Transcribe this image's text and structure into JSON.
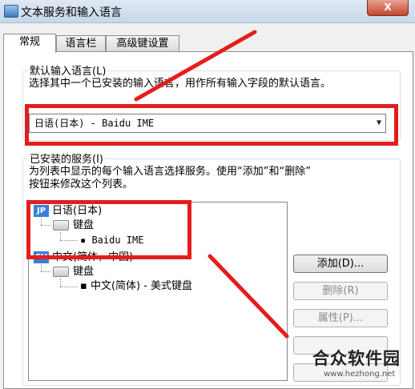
{
  "window": {
    "title": "文本服务和输入语言",
    "close_glyph": "X"
  },
  "tabs": [
    {
      "label": "常规",
      "active": true
    },
    {
      "label": "语言栏",
      "active": false
    },
    {
      "label": "高级键设置",
      "active": false
    }
  ],
  "default_language": {
    "group_label": "默认输入语言(L)",
    "description": "选择其中一个已安装的输入语言，用作所有输入字段的默认语言。",
    "selected": "日语(日本) - Baidu IME",
    "arrow_glyph": "▼"
  },
  "installed_services": {
    "group_label": "已安装的服务(I)",
    "description_line1": "为列表中显示的每个输入语言选择服务。使用“添加”和“删除”",
    "description_line2": "按钮来修改这个列表。",
    "tree": [
      {
        "badge": "JP",
        "language": "日语(日本)",
        "category": "键盘",
        "service": "Baidu IME"
      },
      {
        "badge": "CH",
        "language": "中文(简体，中国)",
        "category": "键盘",
        "service": "中文(简体) - 美式键盘"
      }
    ]
  },
  "buttons": {
    "add": "添加(D)...",
    "remove": "删除(R)",
    "properties": "属性(P)..."
  },
  "annotation_color": "#e41d1d",
  "watermark": {
    "text": "合众软件园",
    "url": "www.hezhong.net"
  }
}
